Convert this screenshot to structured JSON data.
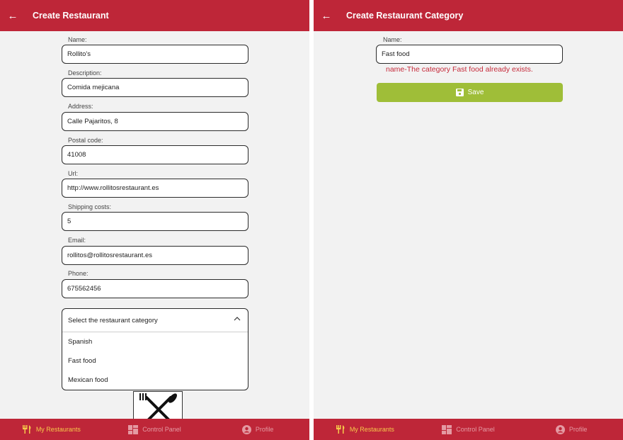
{
  "left": {
    "title": "Create Restaurant",
    "fields": [
      {
        "label": "Name:",
        "value": "Rollito's"
      },
      {
        "label": "Description:",
        "value": "Comida mejicana"
      },
      {
        "label": "Address:",
        "value": "Calle Pajaritos, 8"
      },
      {
        "label": "Postal code:",
        "value": "41008"
      },
      {
        "label": "Url:",
        "value": "http://www.rollitosrestaurant.es"
      },
      {
        "label": "Shipping costs:",
        "value": "5"
      },
      {
        "label": "Email:",
        "value": "rollitos@rollitosrestaurant.es"
      },
      {
        "label": "Phone:",
        "value": "675562456"
      }
    ],
    "category_select": {
      "placeholder": "Select the restaurant category",
      "options": [
        "Spanish",
        "Fast food",
        "Mexican food"
      ]
    }
  },
  "right": {
    "title": "Create Restaurant Category",
    "name_label": "Name:",
    "name_value": "Fast food",
    "error": "name-The category Fast food already exists.",
    "save_label": "Save"
  },
  "tabs": [
    {
      "label": "My Restaurants",
      "icon": "utensils-icon",
      "active": true
    },
    {
      "label": "Control Panel",
      "icon": "dashboard-icon",
      "active": false
    },
    {
      "label": "Profile",
      "icon": "profile-icon",
      "active": false
    }
  ],
  "colors": {
    "header": "#be2638",
    "active_tab": "#f6c94a",
    "inactive_tab": "#e49aa3",
    "save_button": "#9fbe38",
    "error_text": "#c62a3a"
  }
}
